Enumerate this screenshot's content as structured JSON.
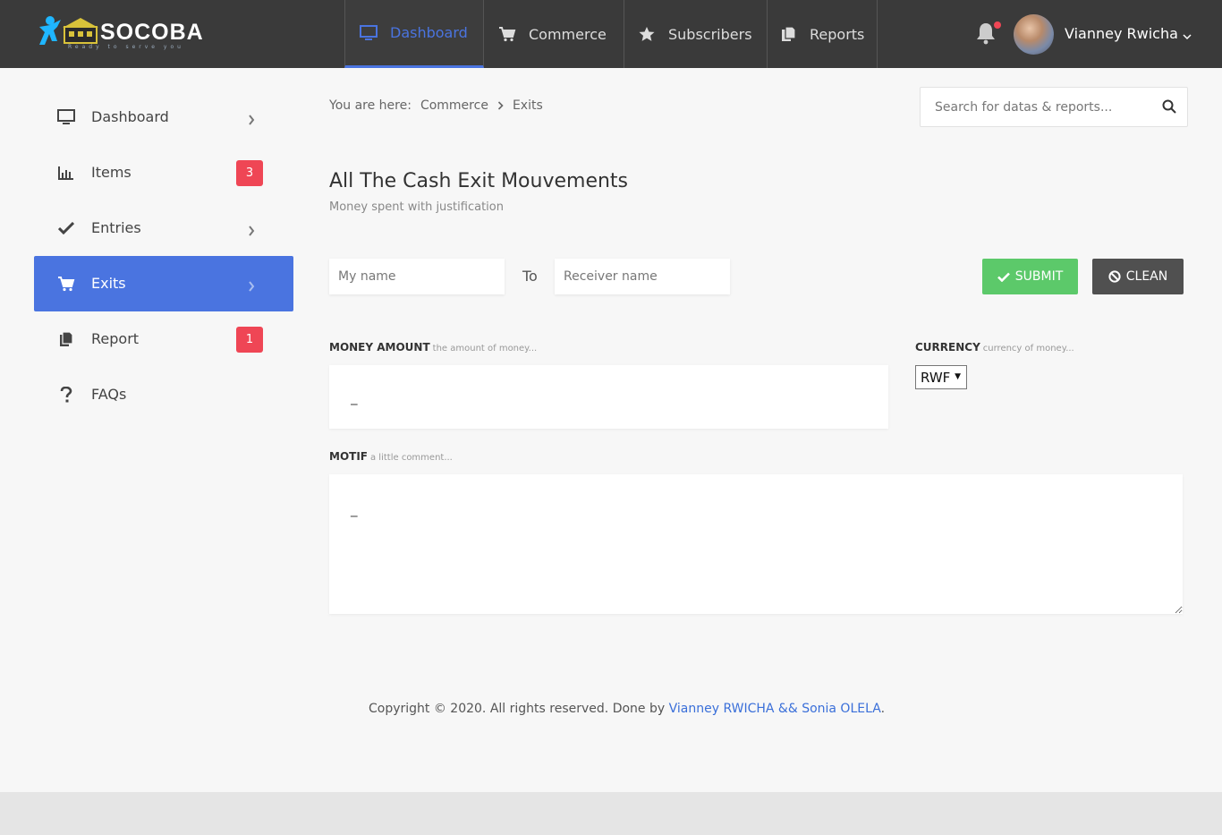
{
  "brand": {
    "name": "SOCOBA",
    "tagline": "Ready to serve you"
  },
  "nav": {
    "items": [
      {
        "label": "Dashboard",
        "icon": "monitor-icon",
        "active": true
      },
      {
        "label": "Commerce",
        "icon": "cart-icon",
        "active": false
      },
      {
        "label": "Subscribers",
        "icon": "star-icon",
        "active": false
      },
      {
        "label": "Reports",
        "icon": "documents-icon",
        "active": false
      }
    ],
    "active_color": "#4a74e0"
  },
  "user": {
    "name": "Vianney Rwicha",
    "has_notification": true
  },
  "sidebar": {
    "items": [
      {
        "label": "Dashboard",
        "icon": "monitor-icon",
        "badge": null,
        "chevron": true,
        "active": false
      },
      {
        "label": "Items",
        "icon": "bar-chart-icon",
        "badge": "3",
        "chevron": false,
        "active": false
      },
      {
        "label": "Entries",
        "icon": "check-icon",
        "badge": null,
        "chevron": true,
        "active": false
      },
      {
        "label": "Exits",
        "icon": "cart-icon",
        "badge": null,
        "chevron": true,
        "active": true
      },
      {
        "label": "Report",
        "icon": "documents-icon",
        "badge": "1",
        "chevron": false,
        "active": false
      },
      {
        "label": "FAQs",
        "icon": "question-icon",
        "badge": null,
        "chevron": false,
        "active": false
      }
    ],
    "badge_color": "#ef4655"
  },
  "breadcrumb": {
    "prefix": "You are here:",
    "items": [
      "Commerce",
      "Exits"
    ]
  },
  "search": {
    "placeholder": "Search for datas & reports..."
  },
  "page": {
    "title": "All The Cash Exit Mouvements",
    "subtitle": "Money spent with justification"
  },
  "form": {
    "from_placeholder": "My name",
    "to_label": "To",
    "to_placeholder": "Receiver name",
    "submit_label": "SUBMIT",
    "clean_label": "CLEAN",
    "submit_color": "#5cc96a",
    "clean_color": "#505050",
    "amount_label": "MONEY AMOUNT",
    "amount_hint": "the amount of money...",
    "amount_value": "_",
    "currency_label": "CURRENCY",
    "currency_hint": "currency of money...",
    "currency_value": "RWF",
    "motif_label": "MOTIF",
    "motif_hint": "a little comment...",
    "motif_value": "_"
  },
  "footer": {
    "text": "Copyright © 2020. All rights reserved. Done by ",
    "authors": "Vianney RWICHA && Sonia OLELA",
    "end": "."
  }
}
